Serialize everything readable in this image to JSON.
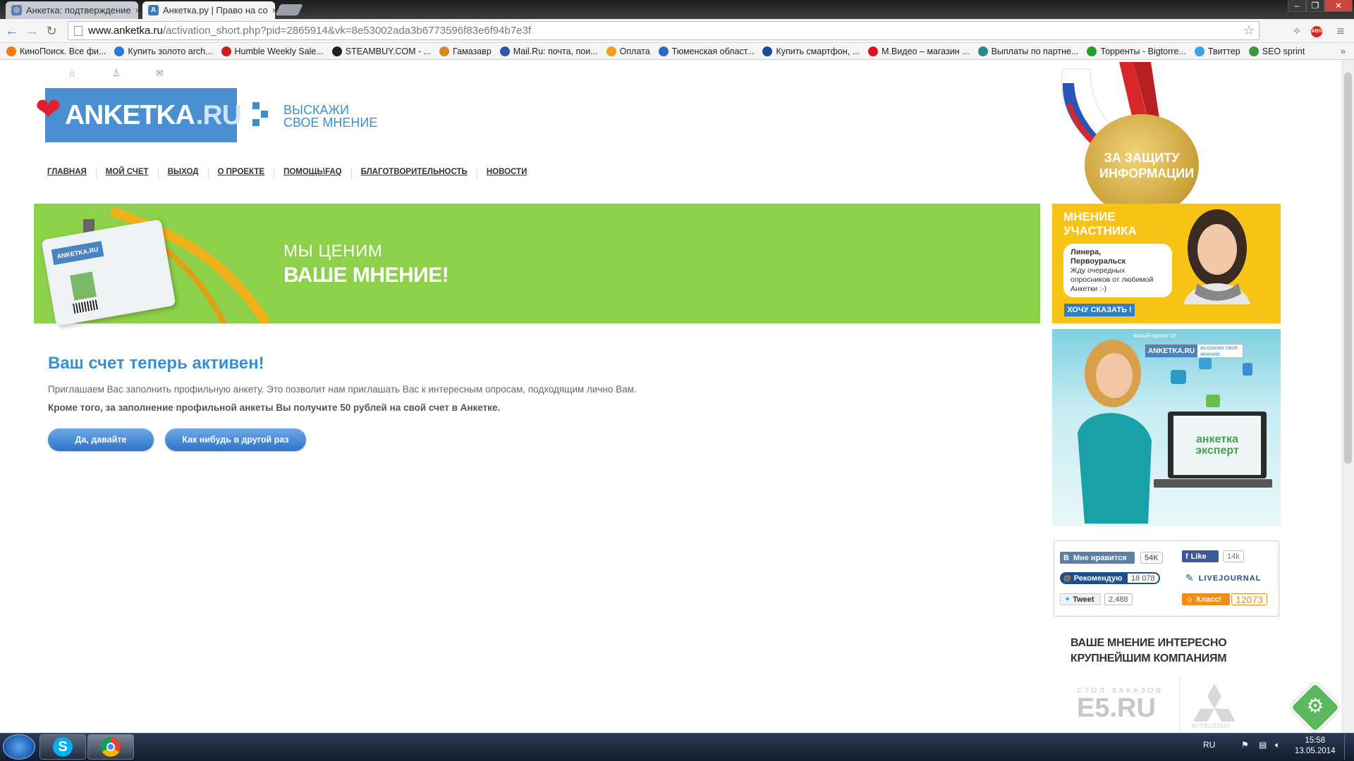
{
  "browser": {
    "tabs": [
      {
        "label": "Анкетка: подтверждение",
        "active": false
      },
      {
        "label": "Анкетка.ру | Право на со",
        "active": true
      }
    ],
    "url_host": "www.anketka.ru",
    "url_path": "/activation_short.php?pid=2865914&vk=8e53002ada3b6773596f83e6f94b7e3f",
    "bookmarks": [
      {
        "label": "КиноПоиск. Все фи...",
        "color": "#ff7a00"
      },
      {
        "label": "Купить золото arch...",
        "color": "#2a7bd8"
      },
      {
        "label": "Humble Weekly Sale...",
        "color": "#cc2020"
      },
      {
        "label": "STEAMBUY.COM - ...",
        "color": "#222222"
      },
      {
        "label": "Гамазавр",
        "color": "#d08a20"
      },
      {
        "label": "Mail.Ru: почта, пои...",
        "color": "#2a5aa8"
      },
      {
        "label": "Оплата",
        "color": "#f0a020"
      },
      {
        "label": "Тюменская област...",
        "color": "#2a6ac8"
      },
      {
        "label": "Купить смартфон, ...",
        "color": "#1a4a9a"
      },
      {
        "label": "М.Видео – магазин ...",
        "color": "#e01020"
      },
      {
        "label": "Выплаты по партне...",
        "color": "#2a8a8a"
      },
      {
        "label": "Торренты - Bigtorre...",
        "color": "#2a9a2a"
      },
      {
        "label": "Твиттер",
        "color": "#3aa0e8"
      },
      {
        "label": "SEO sprint",
        "color": "#3a9a3a"
      }
    ]
  },
  "site": {
    "logo_main": "ANKETKA",
    "logo_suffix": ".RU",
    "slogan_line1": "ВЫСКАЖИ",
    "slogan_line2": "СВОЕ МНЕНИЕ",
    "nav": [
      "ГЛАВНАЯ",
      "МОЙ СЧЕТ",
      "ВЫХОД",
      "О ПРОЕКТЕ",
      "ПОМОЩЬ\\FAQ",
      "БЛАГОТВОРИТЕЛЬНОСТЬ",
      "НОВОСТИ"
    ],
    "banner_line1": "МЫ ЦЕНИМ",
    "banner_line2": "ВАШЕ МНЕНИЕ!",
    "badge_logo": "ANKETKA.RU",
    "medal_text": "ЗА ЗАЩИТУ ИНФОРМАЦИИ"
  },
  "main": {
    "heading": "Ваш счет теперь активен!",
    "paragraph1": "Приглашаем Вас заполнить профильную анкету. Это позволит нам приглашать Вас к интересным опросам, подходящим лично Вам.",
    "paragraph2": "Кроме того, за заполнение профильной анкеты Вы получите 50 рублей на свой счет в Анкетке.",
    "btn_yes": "Да, давайте",
    "btn_later": "Как нибудь в другой раз"
  },
  "sidebar": {
    "opinion_title_1": "МНЕНИЕ",
    "opinion_title_2": "УЧАСТНИКА",
    "quote_name": "Линера,",
    "quote_city": "Первоуральск",
    "quote_text": "Жду очередных опросников от любимой Анкетки :-)",
    "say_button": "ХОЧУ СКАЗАТЬ !",
    "expert_new": "новый проект от",
    "expert_logo": "ANKETKA.RU",
    "expert_slogan": "высказки своё мнение",
    "expert_screen_1": "анкетка",
    "expert_screen_2": "эксперт",
    "social": {
      "vk_label": "Мне нравится",
      "vk_count": "54K",
      "fb_label": "Like",
      "fb_count": "14k",
      "mail_label": "Рекомендую",
      "mail_count": "18 078",
      "lj_label": "LIVEJOURNAL",
      "tw_label": "Tweet",
      "tw_count": "2,488",
      "ok_label": "Класс!",
      "ok_count": "12073"
    },
    "companies_1": "ВАШЕ МНЕНИЕ ИНТЕРЕСНО",
    "companies_2": "КРУПНЕЙШИМ КОМПАНИЯМ",
    "e5_top": "СТОЛ ЗАКАЗОВ",
    "e5_main": "E5.RU",
    "mitsubishi": "MITSUBISHI"
  },
  "taskbar": {
    "lang": "RU",
    "time": "15:58",
    "date": "13.05.2014"
  },
  "colors": {
    "brand_blue": "#3a8fd3",
    "banner_green": "#8dd04a",
    "opinion_yellow": "#f7c314"
  }
}
